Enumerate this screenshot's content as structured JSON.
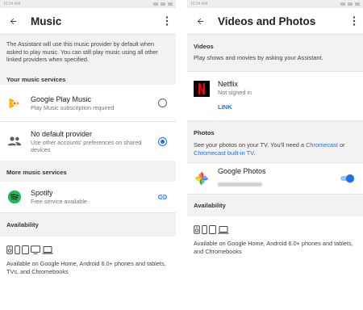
{
  "colors": {
    "accent": "#1a73e8",
    "section_bg": "#f2f2f2",
    "spotify": "#1db954",
    "netflix_red": "#e50914"
  },
  "left": {
    "status_time": "10:14 AM",
    "title": "Music",
    "description": "The Assistant will use this music provider by default when asked to play music. You can still play music using all other linked providers when specified.",
    "your_services_header": "Your music services",
    "services": [
      {
        "title": "Google Play Music",
        "subtitle": "Play Music subscription required",
        "icon": "google-play-music-icon",
        "selected": false
      },
      {
        "title": "No default provider",
        "subtitle": "Use other accounts' preferences on shared devices",
        "icon": "people-icon",
        "selected": true
      }
    ],
    "more_services_header": "More music services",
    "spotify": {
      "title": "Spotify",
      "subtitle": "Free service available",
      "icon": "spotify-icon",
      "action_icon": "link-icon"
    },
    "availability_header": "Availability",
    "availability_text": "Available on Google Home, Android 6.0+ phones and tablets, TVs, and Chromebooks"
  },
  "right": {
    "status_time": "10:14 AM",
    "title": "Videos and Photos",
    "videos_header": "Videos",
    "videos_text": "Play shows and movies by asking your Assistant.",
    "netflix": {
      "title": "Netflix",
      "subtitle": "Not signed in",
      "link_label": "LINK",
      "icon": "netflix-icon"
    },
    "photos_header": "Photos",
    "photos_text_prefix": "See your photos on your TV. You'll need a ",
    "photos_link1": "Chromecast",
    "photos_text_mid": " or",
    "photos_link2": "Chromecast built-in TV",
    "photos_text_suffix": ".",
    "google_photos": {
      "title": "Google Photos",
      "icon": "google-photos-icon",
      "enabled": true
    },
    "availability_header": "Availability",
    "availability_text": "Available on Google Home, Android 6.0+ phones and tablets, and Chromebooks"
  }
}
